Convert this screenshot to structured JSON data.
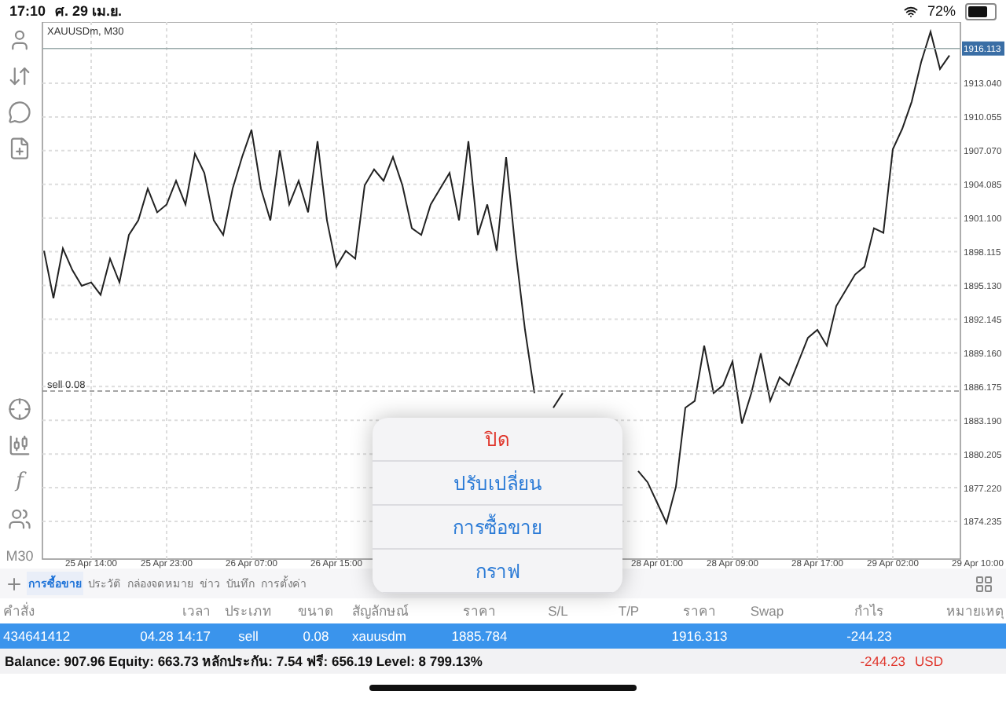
{
  "status_bar": {
    "time": "17:10",
    "date": "ศ. 29 เม.ย.",
    "battery": "72%"
  },
  "toolbar": {
    "items": [
      {
        "kind": "account"
      },
      {
        "kind": "trade"
      },
      {
        "kind": "chat"
      },
      {
        "kind": "new-document"
      },
      {
        "kind": "spacer"
      },
      {
        "kind": "crosshair"
      },
      {
        "kind": "candles"
      },
      {
        "kind": "text",
        "label": "f"
      },
      {
        "kind": "objects"
      },
      {
        "kind": "text",
        "label": "M30"
      }
    ]
  },
  "chart": {
    "title": "XAUUSDm, M30",
    "end_time_label": "29 Apr 10:00",
    "chart_data": {
      "type": "line",
      "grid": true,
      "ylim": [
        1870.9,
        1918.46
      ],
      "categories": [
        null,
        null,
        null,
        null,
        null,
        "25 Apr 14:00",
        null,
        null,
        null,
        null,
        null,
        null,
        null,
        "25 Apr 23:00",
        null,
        null,
        null,
        null,
        null,
        null,
        null,
        null,
        "26 Apr 07:00",
        null,
        null,
        null,
        null,
        null,
        null,
        null,
        null,
        "26 Apr 15:00",
        null,
        null,
        null,
        null,
        null,
        null,
        null,
        null,
        null,
        null,
        null,
        null,
        null,
        null,
        null,
        null,
        null,
        null,
        null,
        null,
        null,
        null,
        null,
        null,
        null,
        null,
        null,
        null,
        null,
        null,
        null,
        null,
        null,
        "28 Apr 01:00",
        null,
        null,
        null,
        null,
        null,
        null,
        null,
        "28 Apr 09:00",
        null,
        null,
        null,
        null,
        null,
        null,
        null,
        null,
        "28 Apr 17:00",
        null,
        null,
        null,
        null,
        null,
        null,
        null,
        "29 Apr 02:00",
        null,
        null,
        null,
        null,
        null,
        null
      ],
      "yticks": [
        {
          "value": 1874.235,
          "label": "1874.235"
        },
        {
          "value": 1877.22,
          "label": "1877.220"
        },
        {
          "value": 1880.205,
          "label": "1880.205"
        },
        {
          "value": 1883.19,
          "label": "1883.190"
        },
        {
          "value": 1886.175,
          "label": "1886.175"
        },
        {
          "value": 1889.16,
          "label": "1889.160"
        },
        {
          "value": 1892.145,
          "label": "1892.145"
        },
        {
          "value": 1895.13,
          "label": "1895.130"
        },
        {
          "value": 1898.115,
          "label": "1898.115"
        },
        {
          "value": 1901.1,
          "label": "1901.100"
        },
        {
          "value": 1904.085,
          "label": "1904.085"
        },
        {
          "value": 1907.07,
          "label": "1907.070"
        },
        {
          "value": 1910.055,
          "label": "1910.055"
        },
        {
          "value": 1913.04,
          "label": "1913.040"
        }
      ],
      "series": [
        {
          "color": "#222222",
          "values": [
            1898.2,
            1894.0,
            1898.4,
            1896.5,
            1895.1,
            1895.4,
            1894.3,
            1897.5,
            1895.4,
            1899.6,
            1900.9,
            1903.7,
            1901.6,
            1902.3,
            1904.4,
            1902.3,
            1906.8,
            1905.1,
            1900.9,
            1899.6,
            1903.7,
            1906.5,
            1908.9,
            1903.7,
            1900.9,
            1907.1,
            1902.3,
            1904.4,
            1901.6,
            1907.9,
            1900.9,
            1896.8,
            1898.2,
            1897.5,
            1904.0,
            1905.4,
            1904.4,
            1906.5,
            1904.0,
            1900.2,
            1899.6,
            1902.3,
            1903.7,
            1905.1,
            1900.9,
            1907.9,
            1899.6,
            1902.3,
            1898.2,
            1906.5,
            1898.2,
            1891.2,
            1885.6,
            null,
            1884.3,
            1885.6,
            null,
            null,
            null,
            null,
            null,
            null,
            null,
            1878.7,
            1877.7,
            1875.9,
            1874.1,
            1877.3,
            1884.3,
            1884.9,
            1889.8,
            1885.6,
            1886.3,
            1888.4,
            1882.9,
            1885.6,
            1889.1,
            1884.9,
            1887.0,
            1886.3,
            1888.4,
            1890.5,
            1891.2,
            1889.8,
            1893.3,
            1894.7,
            1896.1,
            1896.8,
            1900.2,
            1899.8,
            1907.2,
            1909.0,
            1911.4,
            1914.9,
            1917.6,
            1914.3,
            1915.5
          ]
        }
      ],
      "ref_lines": [
        {
          "axis": "y",
          "value": 1916.113,
          "label": "1916.113"
        },
        {
          "axis": "y",
          "value": 1885.784,
          "label": "sell 0.08"
        }
      ]
    }
  },
  "menu": {
    "items": [
      {
        "label": "ปิด",
        "kind": "destructive"
      },
      {
        "label": "ปรับเปลี่ยน",
        "kind": "action"
      },
      {
        "label": "การซื้อขาย",
        "kind": "action"
      },
      {
        "label": "กราฟ",
        "kind": "action"
      }
    ]
  },
  "tabs": [
    {
      "label": "การซื้อขาย",
      "selected": true
    },
    {
      "label": "ประวัติ",
      "selected": false
    },
    {
      "label": "กล่องจดหมาย",
      "selected": false
    },
    {
      "label": "ข่าว",
      "selected": false
    },
    {
      "label": "บันทึก",
      "selected": false
    },
    {
      "label": "การตั้งค่า",
      "selected": false
    }
  ],
  "table": {
    "columns": [
      "คำสั่ง",
      "เวลา",
      "ประเภท",
      "ขนาด",
      "สัญลักษณ์",
      "ราคา",
      "S/L",
      "T/P",
      "ราคา",
      "Swap",
      "กำไร",
      "หมายเหตุ"
    ],
    "rows": [
      {
        "selected": true,
        "cells": [
          "434641412",
          "04.28 14:17",
          "sell",
          "0.08",
          "xauusdm",
          "1885.784",
          "",
          "",
          "1916.313",
          "",
          "-244.23",
          ""
        ]
      }
    ]
  },
  "summary": {
    "text": "Balance: 907.96 Equity: 663.73 หลักประกัน: 7.54 ฟรี: 656.19 Level: 8 799.13%",
    "profit": "-244.23",
    "currency": "USD"
  }
}
